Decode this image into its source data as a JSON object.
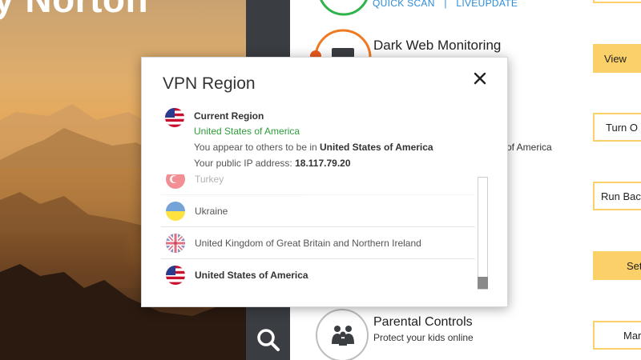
{
  "app": {
    "brand": "y Norton"
  },
  "main": {
    "quick_scan": "QUICK SCAN",
    "separator": "|",
    "liveupdate": "LIVEUPDATE",
    "dark_web_title": "Dark Web Monitoring",
    "behind_text": "of America",
    "parental_title": "Parental Controls",
    "parental_sub": "Protect your kids online",
    "buttons": {
      "view": "View",
      "turn_on": "Turn O",
      "run_backup": "Run Bac",
      "set": "Set",
      "manage": "Mar"
    }
  },
  "dialog": {
    "title": "VPN Region",
    "current_region_label": "Current Region",
    "current_region_value": "United States of America",
    "appear_prefix": "You appear to others to be in ",
    "appear_country": "United States of America",
    "ip_prefix": "Your public IP address: ",
    "ip_value": "18.117.79.20",
    "regions": [
      {
        "name": "Turkey",
        "flag": "turkey-flag",
        "state": "faded"
      },
      {
        "name": "Ukraine",
        "flag": "ukraine-flag",
        "state": "normal"
      },
      {
        "name": "United Kingdom of Great Britain and Northern Ireland",
        "flag": "uk-flag",
        "state": "normal"
      },
      {
        "name": "United States of America",
        "flag": "usa-flag",
        "state": "selected"
      }
    ]
  },
  "colors": {
    "accent_yellow": "#fcd068",
    "link_blue": "#2a8bd8",
    "region_green": "#2e9e3b",
    "strip_dark": "#3a3d42"
  }
}
